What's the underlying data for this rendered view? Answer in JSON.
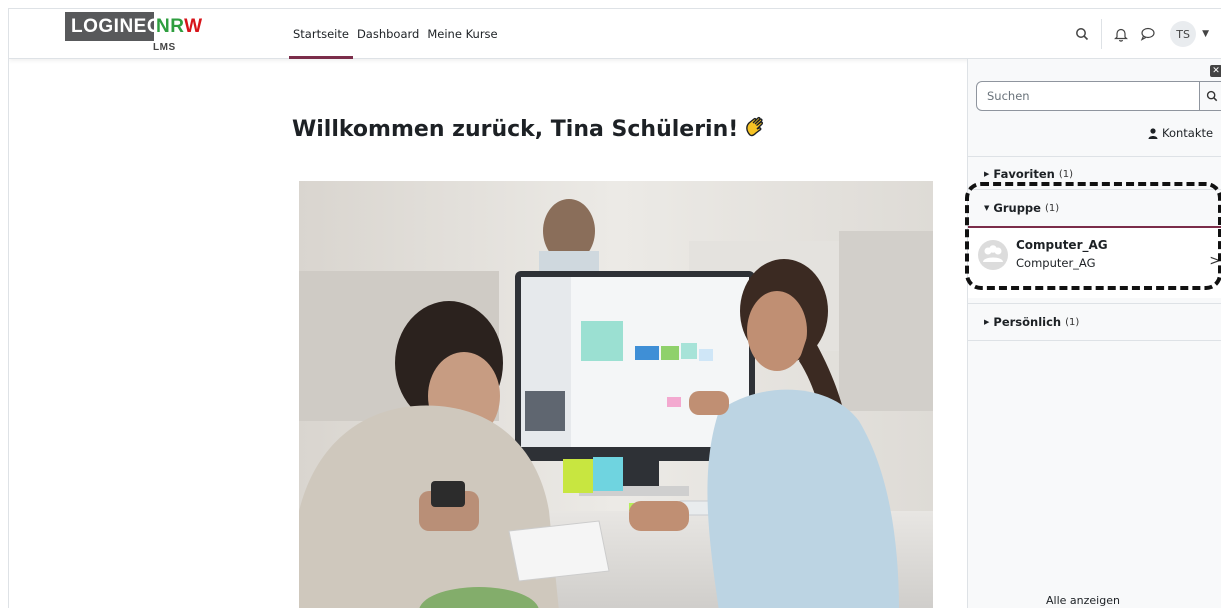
{
  "brand": {
    "logo_left": "LOGINEO",
    "logo_nr": "NR",
    "logo_w": "W",
    "logo_sub": "LMS"
  },
  "nav": {
    "links": [
      {
        "label": "Startseite",
        "active": true
      },
      {
        "label": "Dashboard",
        "active": false
      },
      {
        "label": "Meine Kurse",
        "active": false
      }
    ],
    "user_initials": "TS"
  },
  "main": {
    "welcome": "Willkommen zurück, Tina Schülerin!"
  },
  "drawer": {
    "search_placeholder": "Suchen",
    "contacts_label": "Kontakte",
    "sections": {
      "favorites": {
        "label": "Favoriten",
        "count": "(1)"
      },
      "group": {
        "label": "Gruppe",
        "count": "(1)",
        "item": {
          "name": "Computer_AG",
          "subtitle": "Computer_AG"
        }
      },
      "personal": {
        "label": "Persönlich",
        "count": "(1)"
      }
    },
    "show_all": "Alle anzeigen"
  },
  "colors": {
    "accent": "#7b2d4a",
    "brand_grey": "#58595b",
    "brand_green": "#2e9e3f",
    "brand_red": "#d7141a"
  }
}
